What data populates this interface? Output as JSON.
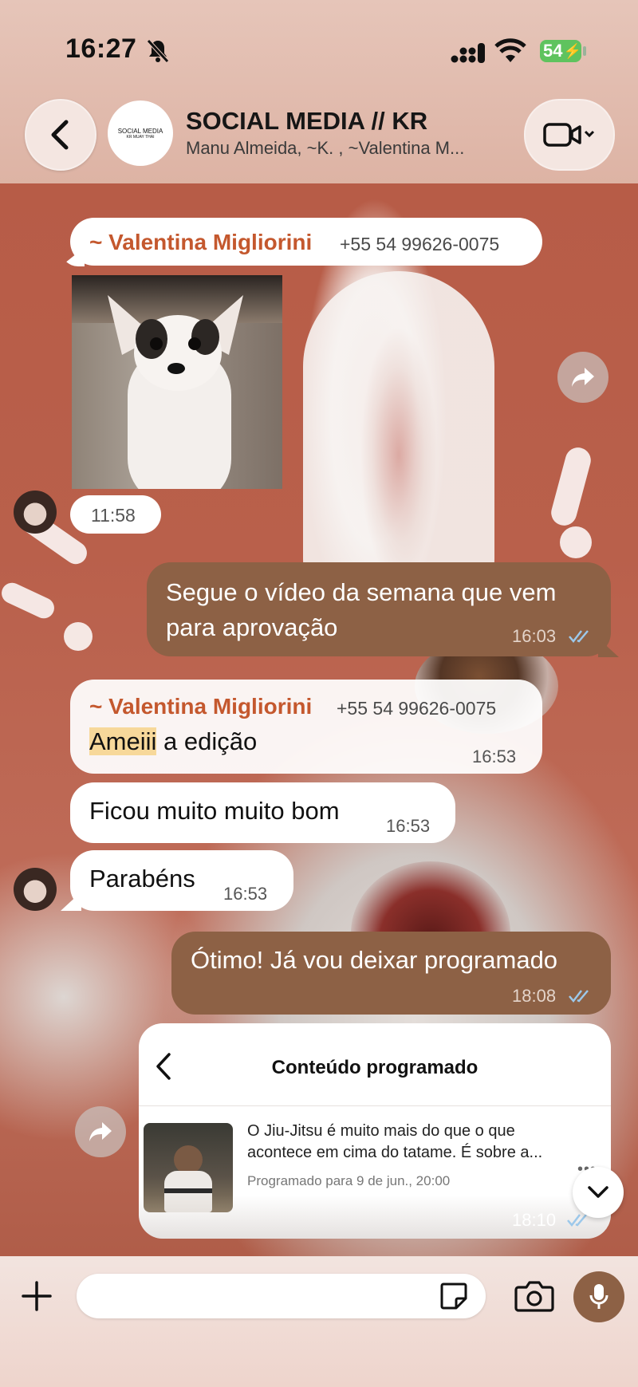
{
  "status_bar": {
    "time": "16:27",
    "battery": "54"
  },
  "header": {
    "group_title": "SOCIAL MEDIA // KR",
    "members": "Manu Almeida, ~K. , ~Valentina M...",
    "avatar_line1": "SOCIAL MEDIA",
    "avatar_line2": "KR MUAY THAI"
  },
  "messages": {
    "m1": {
      "sender": "~ Valentina Migliorini",
      "phone": "+55 54 99626-0075",
      "time": "11:58"
    },
    "m2": {
      "text_line1": "Segue o vídeo da semana que vem",
      "text_line2": "para aprovação",
      "time": "16:03"
    },
    "m3": {
      "sender": "~ Valentina Migliorini",
      "phone": "+55 54 99626-0075",
      "highlight": "Ameiii",
      "text": " a edição",
      "time": "16:53"
    },
    "m4": {
      "text": "Ficou muito muito bom",
      "time": "16:53"
    },
    "m5": {
      "text": "Parabéns",
      "time": "16:53"
    },
    "m6": {
      "text": "Ótimo! Já vou deixar programado",
      "time": "18:08"
    },
    "m7": {
      "card_title": "Conteúdo programado",
      "post_text_line1": "O Jiu-Jitsu é muito mais do que o que",
      "post_text_line2": "acontece em cima do tatame. É sobre a...",
      "scheduled": "Programado para 9 de jun., 20:00",
      "time": "18:10"
    }
  },
  "colors": {
    "outgoing_bubble": "#8d6145",
    "sender_name": "#c4582e",
    "read_ticks": "#9cc8ea",
    "battery": "#5fc35e"
  },
  "icons": [
    "back-icon",
    "video-call-icon",
    "forward-icon",
    "mute-bell-icon",
    "signal-icon",
    "wifi-icon",
    "plus-icon",
    "sticker-icon",
    "camera-icon",
    "microphone-icon",
    "scroll-down-icon",
    "double-check-icon"
  ]
}
